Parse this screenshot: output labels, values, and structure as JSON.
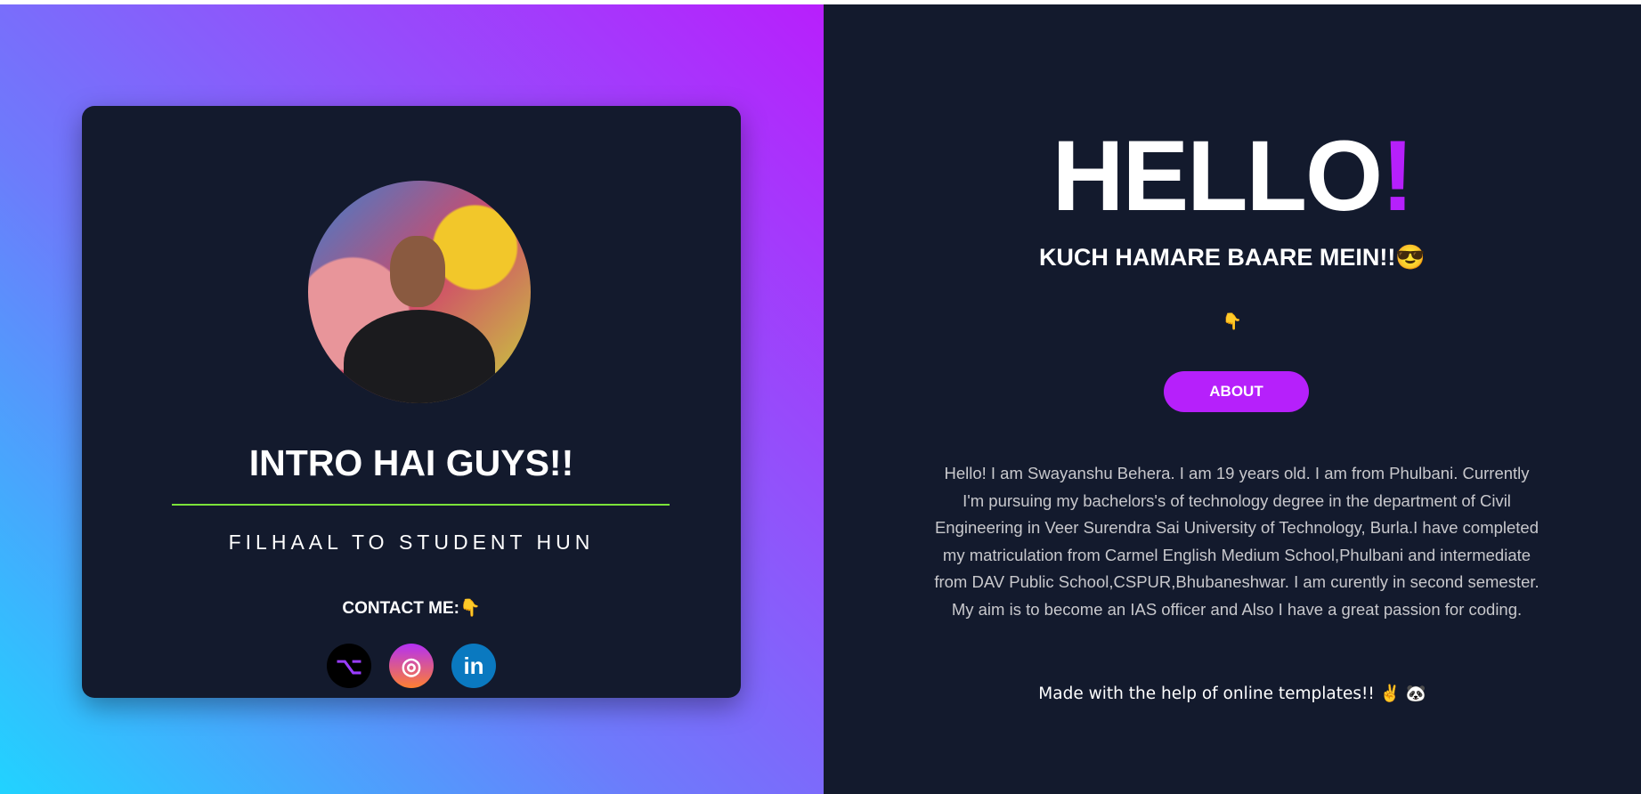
{
  "card": {
    "title": "INTRO HAI GUYS!!",
    "subtitle": "FILHAAL TO STUDENT HUN",
    "contact_label": "CONTACT ME:👇",
    "socials": [
      {
        "name": "github",
        "glyph": "⌥"
      },
      {
        "name": "instagram",
        "glyph": "◎"
      },
      {
        "name": "linkedin",
        "glyph": "in"
      }
    ]
  },
  "main": {
    "hello": "HELLO",
    "hello_mark": "!",
    "heading": "KUCH HAMARE BAARE MEIN!!😎",
    "pointer": "👇",
    "about_button": "ABOUT",
    "paragraph": "Hello! I am Swayanshu Behera. I am 19 years old. I am from Phulbani. Currently I'm pursuing my bachelors's of technology degree in the department of Civil Engineering in Veer Surendra Sai University of Technology, Burla.I have completed my matriculation from Carmel English Medium School,Phulbani and intermediate from DAV Public School,CSPUR,Bhubaneshwar. I am curently in second semester. My aim is to become an IAS officer and Also I have a great passion for coding.",
    "footer": "Made with the help of online templates!! ✌️ 🐼"
  },
  "colors": {
    "accent": "#b620fb",
    "background": "#131a2d",
    "divider": "#7be33a"
  }
}
